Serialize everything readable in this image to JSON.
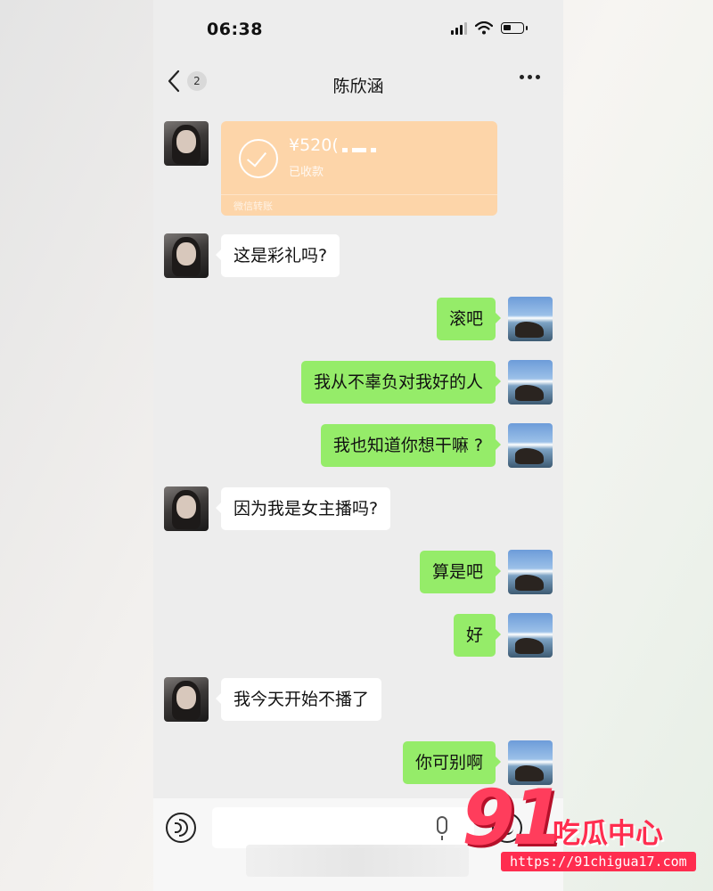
{
  "status_bar": {
    "time": "06:38"
  },
  "nav": {
    "back_icon": "chevron-left-icon",
    "unread_count": "2",
    "title": "陈欣涵",
    "more_icon": "more-dots-icon"
  },
  "chat": {
    "transfer": {
      "amount": "¥520(",
      "status": "已收款",
      "label": "微信转账"
    },
    "messages": [
      {
        "side": "in",
        "text": "这是彩礼吗?"
      },
      {
        "side": "out",
        "text": "滚吧"
      },
      {
        "side": "out",
        "text": "我从不辜负对我好的人"
      },
      {
        "side": "out",
        "text": "我也知道你想干嘛 ?"
      },
      {
        "side": "in",
        "text": "因为我是女主播吗?"
      },
      {
        "side": "out",
        "text": "算是吧"
      },
      {
        "side": "out",
        "text": "好"
      },
      {
        "side": "in",
        "text": "我今天开始不播了"
      },
      {
        "side": "out",
        "text": "你可别啊"
      }
    ]
  },
  "input_bar": {
    "voice_icon": "voice-icon",
    "mic_icon": "microphone-icon",
    "emoji_icon": "emoji-icon",
    "value": ""
  },
  "watermark": {
    "number": "91",
    "name": "吃瓜中心",
    "url": "https://91chigua17.com"
  },
  "colors": {
    "outgoing_bubble": "#95ec69",
    "incoming_bubble": "#ffffff",
    "transfer_card": "#fdd5a9",
    "chat_background": "#ededed"
  }
}
